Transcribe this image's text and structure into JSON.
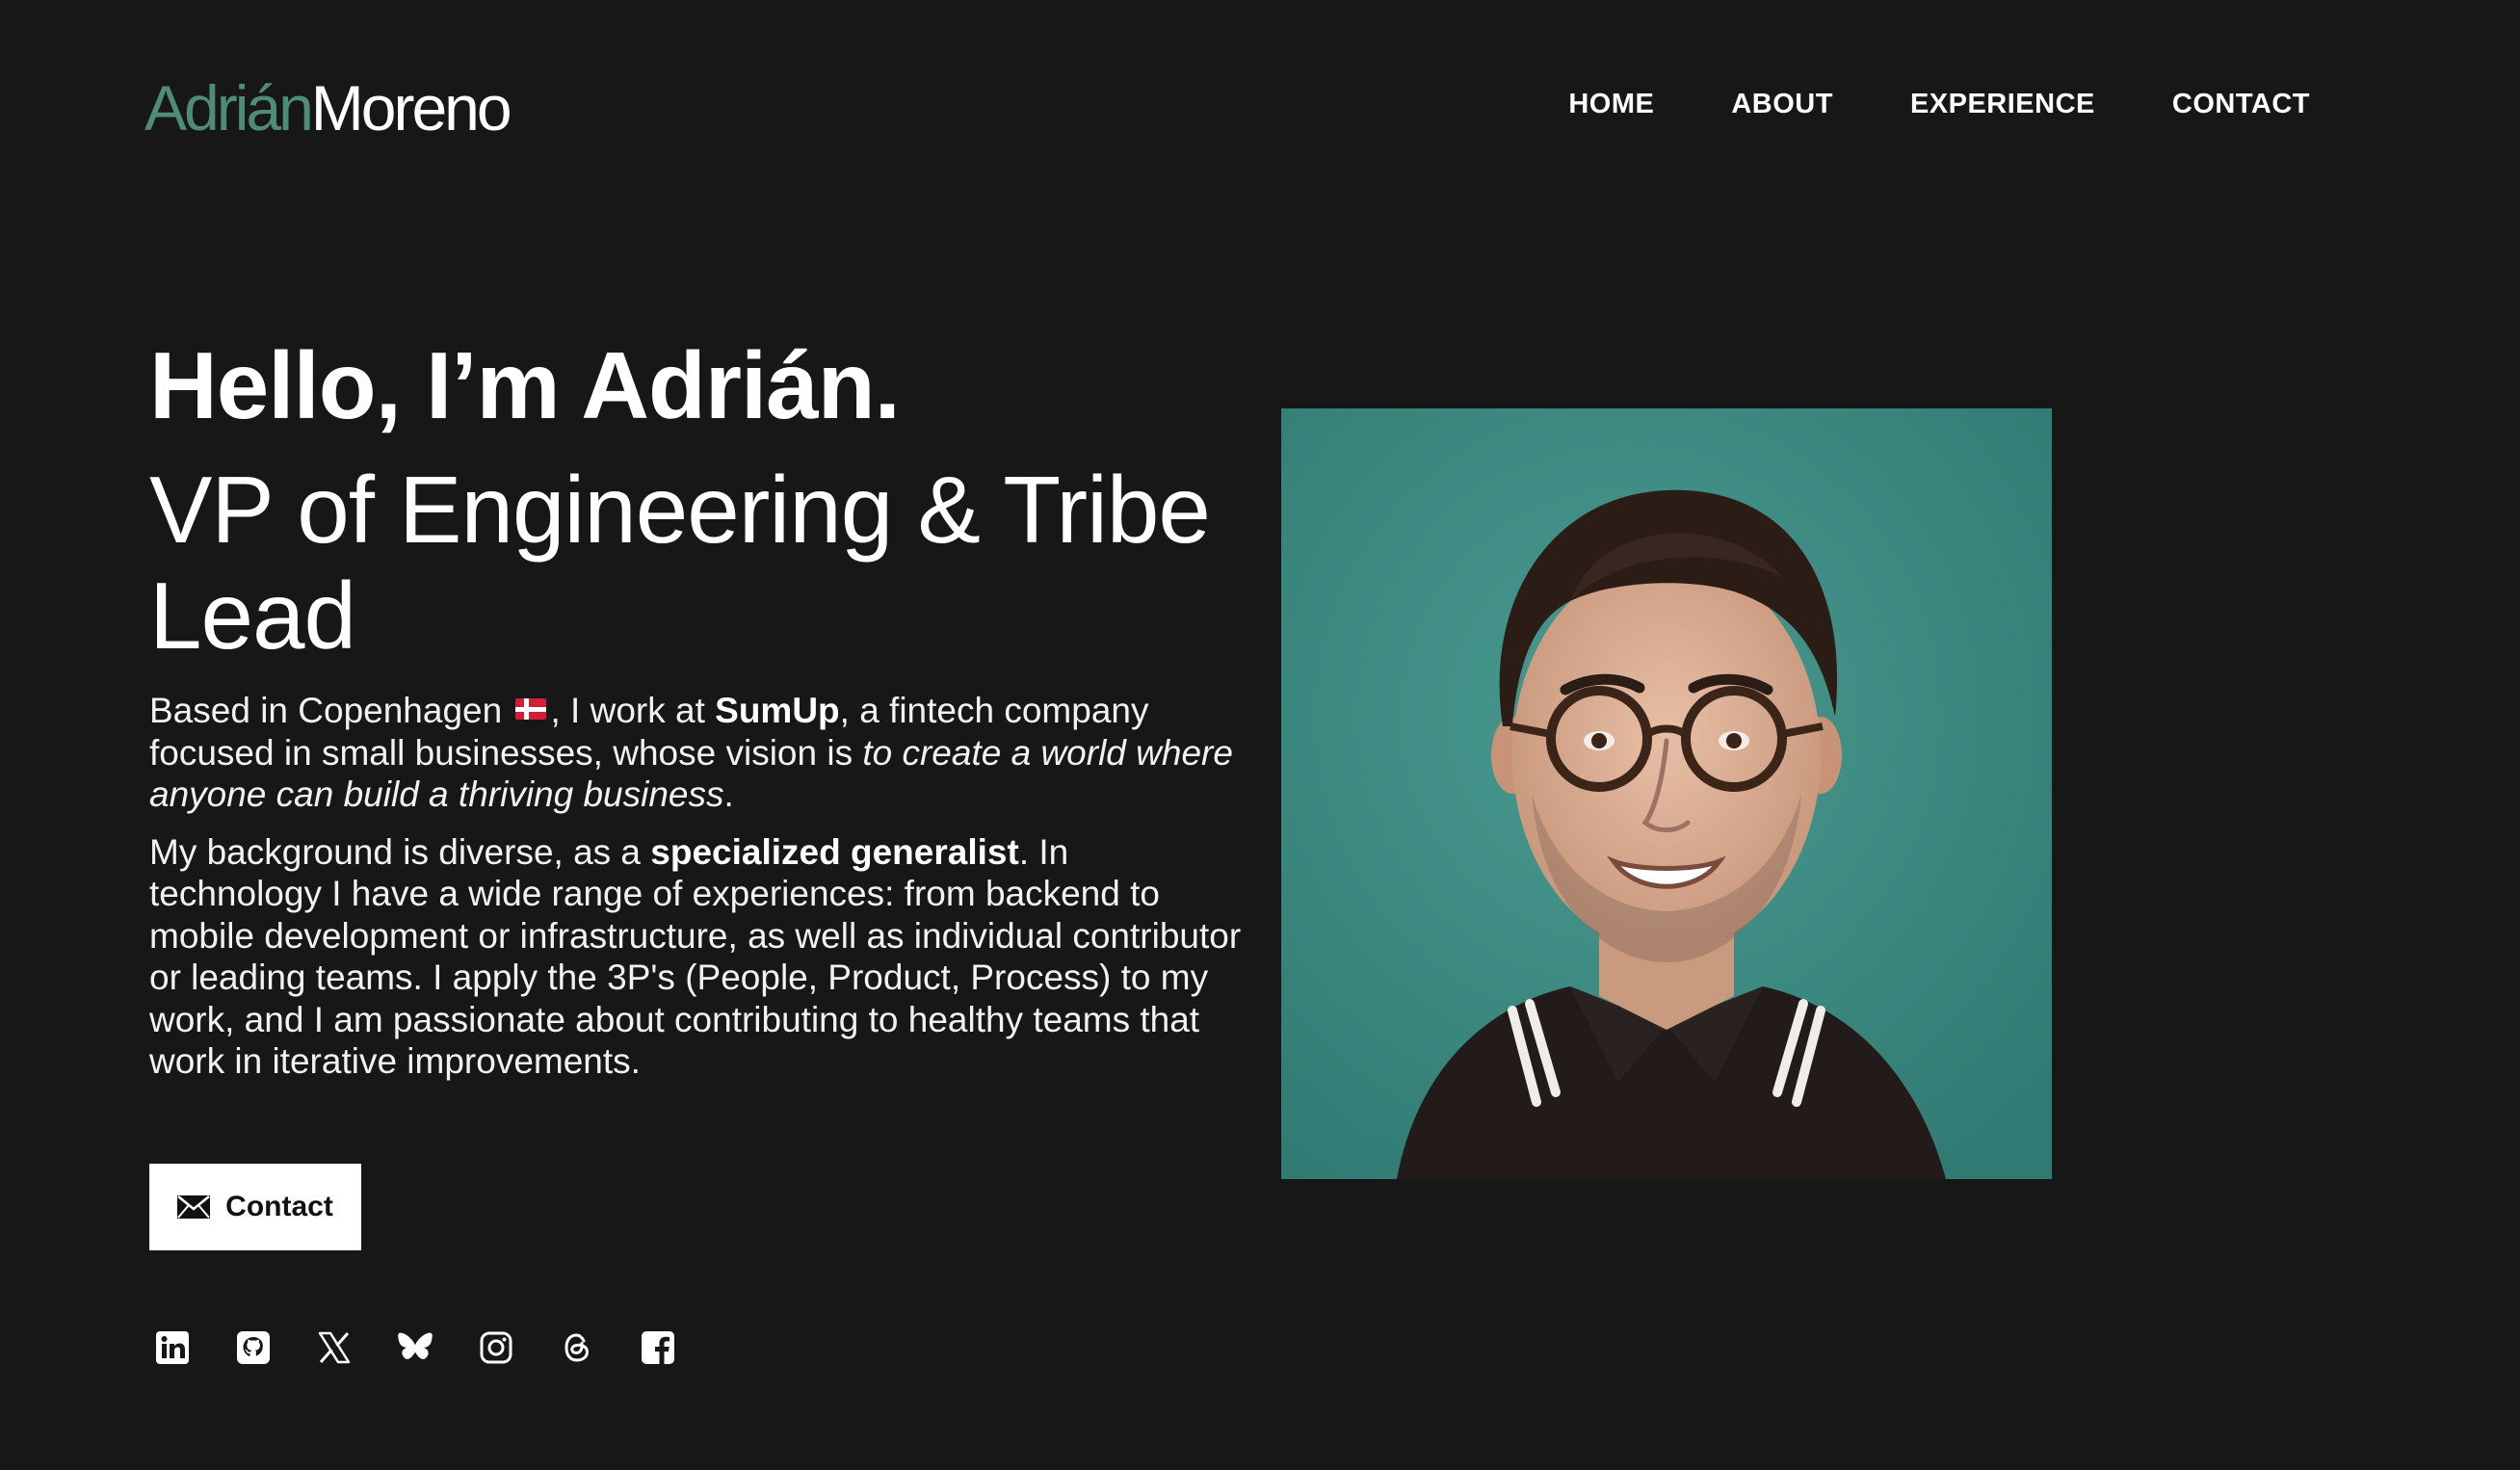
{
  "header": {
    "logo_first": "Adrián",
    "logo_last": "Moreno",
    "nav": [
      {
        "label": "HOME"
      },
      {
        "label": "ABOUT"
      },
      {
        "label": "EXPERIENCE"
      },
      {
        "label": "CONTACT"
      }
    ]
  },
  "hero": {
    "greeting": "Hello, I’m Adrián.",
    "role": "VP of Engineering & Tribe Lead",
    "p1": {
      "t1": "Based in Copenhagen",
      "t2": ", I work at ",
      "company": "SumUp",
      "t3": ", a fintech company focused in small businesses, whose vision is ",
      "vision": "to create a world where anyone can build a thriving business",
      "t4": "."
    },
    "p2": {
      "t1": "My background is diverse, as a ",
      "highlight": "specialized generalist",
      "t2": ". In technology I have a wide range of experiences: from backend to mobile development or infrastructure, as well as individual contributor or leading teams. I apply the 3P's (People, Product, Process) to my work, and I am passionate about contributing to healthy teams that work in iterative improvements."
    },
    "contact_label": "Contact"
  },
  "socials": [
    "linkedin-icon",
    "github-icon",
    "x-icon",
    "bluesky-icon",
    "instagram-icon",
    "threads-icon",
    "facebook-icon"
  ],
  "colors": {
    "background": "#171717",
    "accent": "#4f8c78",
    "portrait_background": "#3e8a81"
  }
}
